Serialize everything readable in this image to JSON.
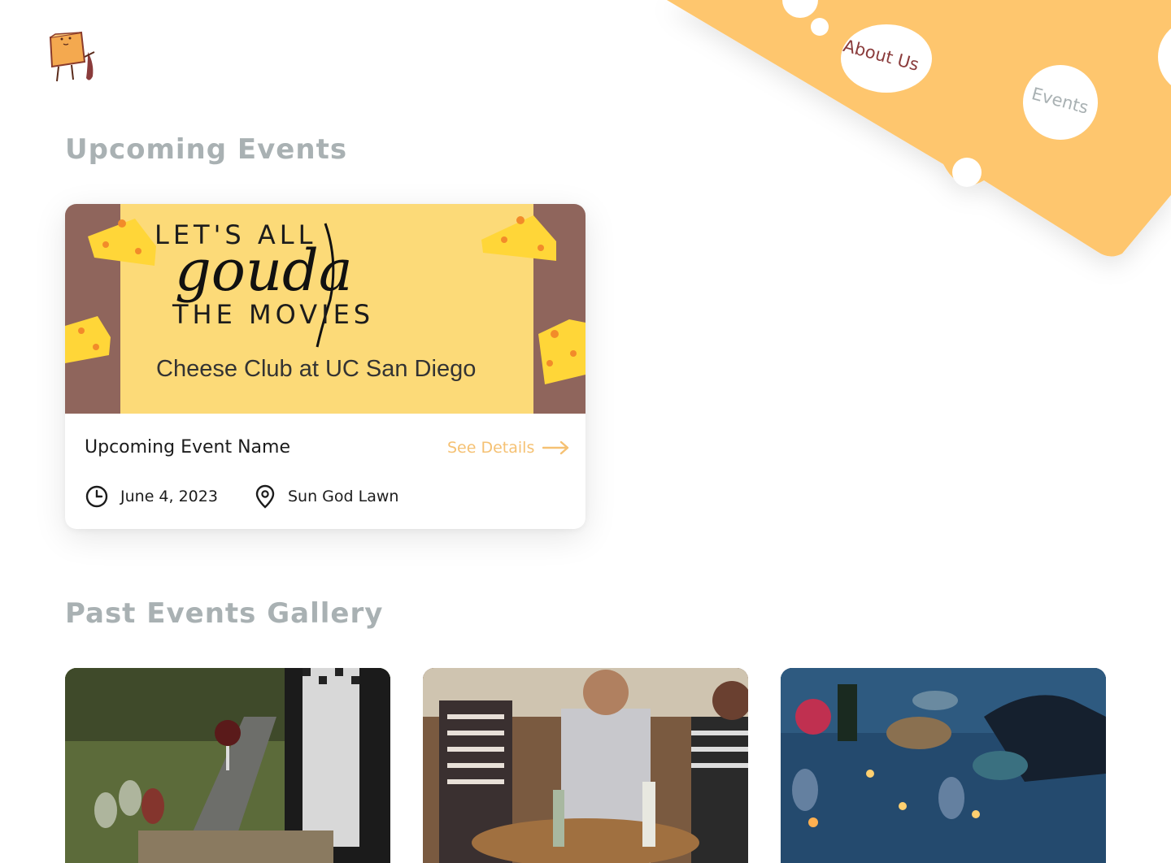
{
  "nav": {
    "about_label": "About Us",
    "events_label": "Events",
    "colors": {
      "cheese": "#fec66e",
      "about": "#8a3b3b",
      "events": "#a9b1b3"
    }
  },
  "logo": {
    "icon": "cheese-mascot-icon"
  },
  "sections": {
    "upcoming_title": "Upcoming Events",
    "past_title": "Past Events Gallery"
  },
  "upcoming_event": {
    "poster": {
      "line1": "LET'S      ALL",
      "script": "gouda",
      "line3": "THE  MOVIES",
      "subtitle": "Cheese Club at UC San Diego"
    },
    "name": "Upcoming Event Name",
    "details_label": "See Details",
    "date": "June 4, 2023",
    "location": "Sun God Lawn",
    "colors": {
      "accent": "#f5c173",
      "poster_bg": "#fcda78",
      "poster_border": "#8f655c"
    }
  },
  "gallery": [
    {
      "icon": "wine-tasting-photo"
    },
    {
      "icon": "friends-party-photo"
    },
    {
      "icon": "dinner-table-photo"
    }
  ]
}
